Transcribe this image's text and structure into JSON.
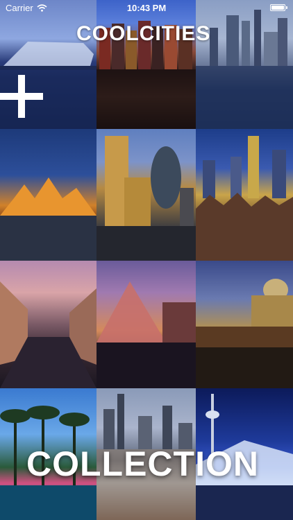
{
  "status_bar": {
    "carrier": "Carrier",
    "time": "10:43 PM",
    "battery_level": 1.0
  },
  "logo": {
    "text": "COOLCITIES"
  },
  "collection": {
    "label": "COLLECTION"
  },
  "icons": {
    "wifi": "wifi-icon",
    "battery": "battery-icon",
    "add": "plus-icon"
  },
  "colors": {
    "text": "#ffffff"
  }
}
